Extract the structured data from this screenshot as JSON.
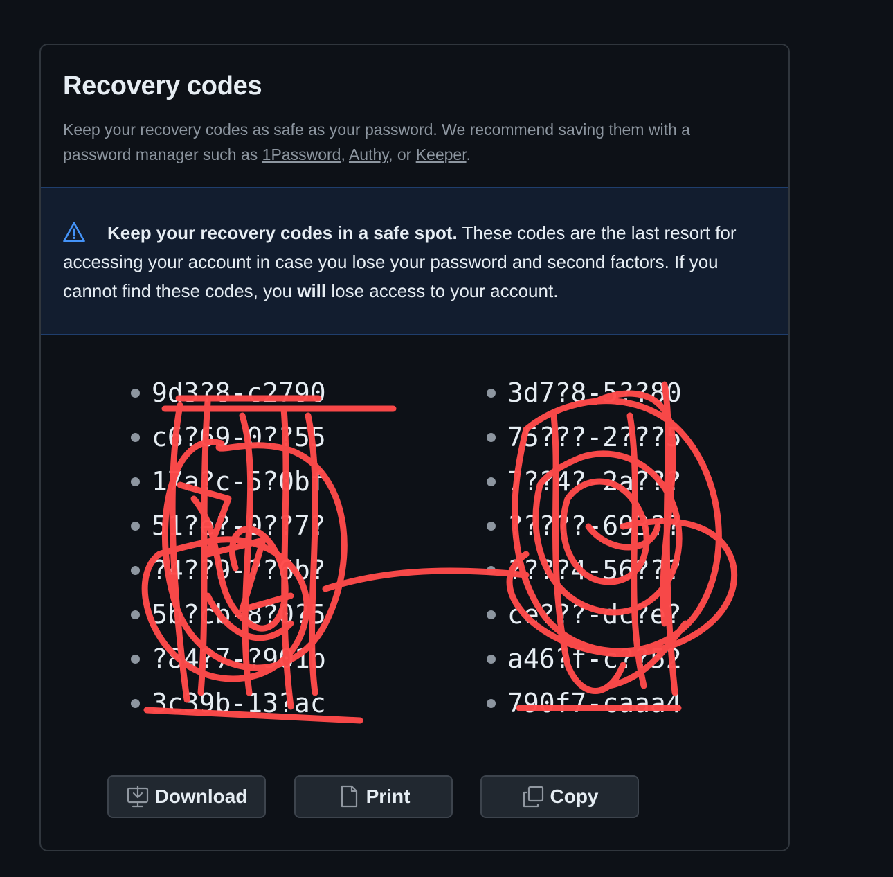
{
  "header": {
    "title": "Recovery codes",
    "desc_prefix": "Keep your recovery codes as safe as your password. We recommend saving them with a password manager such as ",
    "links": [
      "1Password",
      "Authy",
      "Keeper"
    ],
    "sep1": ", ",
    "sep2": ", or ",
    "desc_suffix": "."
  },
  "warning": {
    "icon": "alert-triangle-icon",
    "bold_lead": "Keep your recovery codes in a safe spot.",
    "text_a": " These codes are the last resort for accessing your account in case you lose your password and second factors. If you cannot find these codes, you ",
    "bold_will": "will",
    "text_b": " lose access to your account.",
    "accent_color": "#4493f8"
  },
  "codes": {
    "left": [
      "9d3?8-c2790",
      "c6?69-0??55",
      "17a?c-5?0bf",
      "51?e?-0??7?",
      "?4??9-??6b?",
      "5b?cb-8?0?5",
      "?84?7-?901b",
      "3c39b-13?ac"
    ],
    "right": [
      "3d7?8-5??80",
      "75???-2???5",
      "7??4?-2a???",
      "?????-693??",
      "????4-56???",
      "ce???-dc?e?",
      "a46?f-c??52",
      "790f7-caaa4"
    ],
    "redaction_color": "#ff4a4a"
  },
  "buttons": {
    "download": {
      "label": "Download",
      "icon": "download-icon"
    },
    "print": {
      "label": "Print",
      "icon": "file-icon"
    },
    "copy": {
      "label": "Copy",
      "icon": "copy-icon"
    }
  }
}
